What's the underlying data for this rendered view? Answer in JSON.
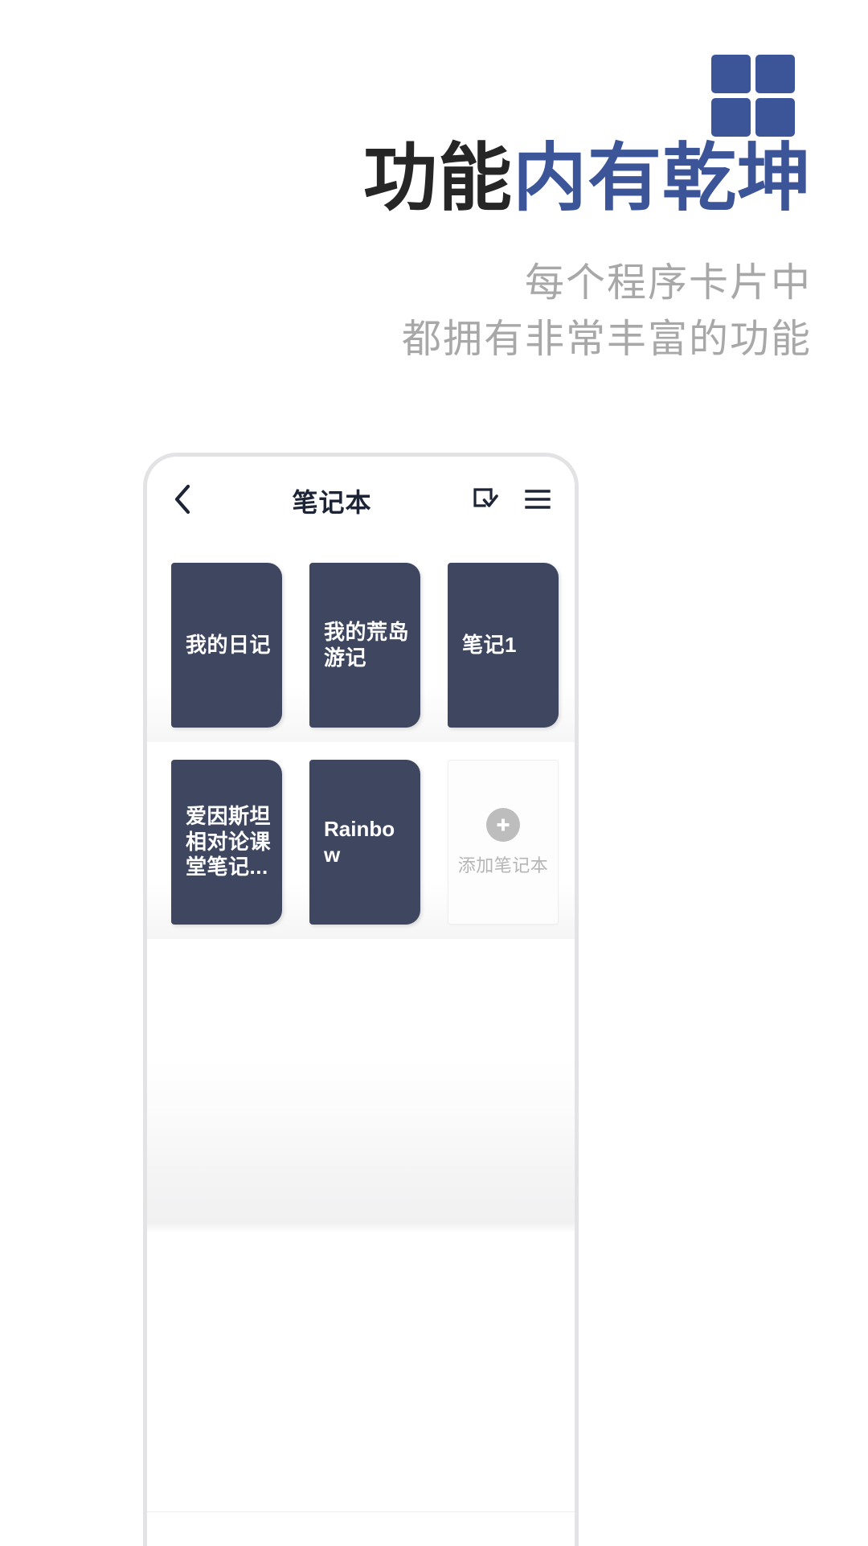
{
  "brand": {
    "logo_name": "grid-squares-logo",
    "accent_color": "#3b5598",
    "squares": 4
  },
  "headline": {
    "dark_text": "功能",
    "accent_text": "内有乾坤",
    "dark_color": "#262626",
    "accent_color": "#3b5598"
  },
  "subtitle": {
    "line1": "每个程序卡片中",
    "line2": "都拥有非常丰富的功能",
    "color": "#a8a8a8"
  },
  "phone": {
    "app_bar": {
      "back_icon": "chevron-left-icon",
      "title": "笔记本",
      "actions": [
        {
          "icon": "select-check-icon"
        },
        {
          "icon": "hamburger-menu-icon"
        }
      ]
    },
    "notebooks": [
      {
        "title": "我的日记",
        "latin": false
      },
      {
        "title": "我的荒岛游记",
        "latin": false
      },
      {
        "title": "笔记1",
        "latin": false
      },
      {
        "title": "爱因斯坦相对论课堂笔记...",
        "latin": false
      },
      {
        "title": "Rainbow",
        "latin": true
      }
    ],
    "add_card": {
      "icon": "plus-circle-icon",
      "label": "添加笔记本"
    },
    "card_color": "#3f4760"
  }
}
